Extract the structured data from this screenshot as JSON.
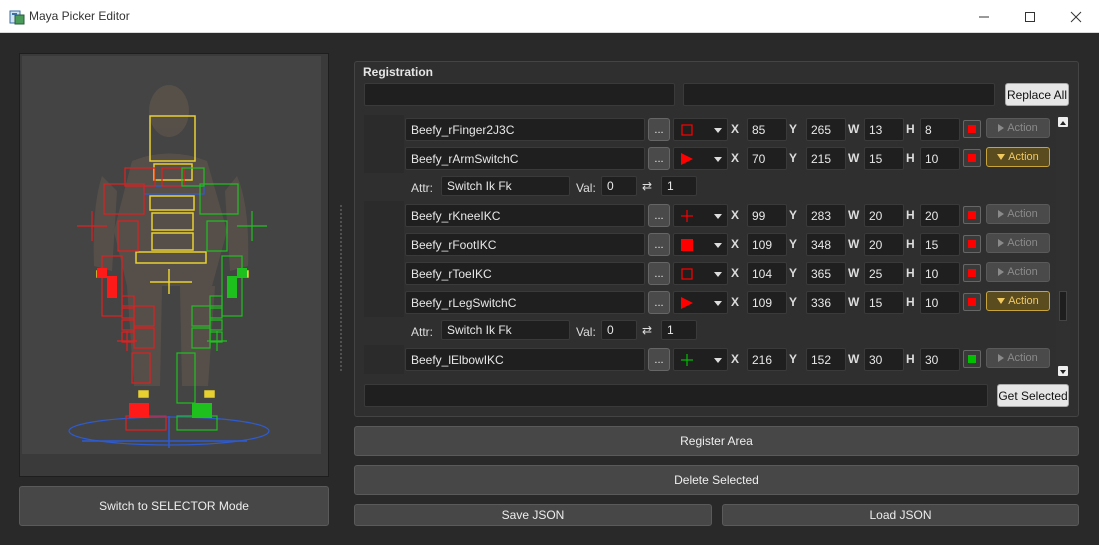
{
  "window": {
    "title": "Maya Picker Editor",
    "icons": {
      "app": "maya-app-icon",
      "minimize": "minimize-icon",
      "maximize": "maximize-icon",
      "close": "close-icon"
    }
  },
  "left": {
    "mode_button": "Switch to SELECTOR Mode"
  },
  "registration": {
    "title": "Registration",
    "find_value": "",
    "replace_value": "",
    "replace_all_label": "Replace All",
    "axis_labels": {
      "x": "X",
      "y": "Y",
      "w": "W",
      "h": "H"
    },
    "dots_label": "...",
    "attr_label": "Attr:",
    "val_label": "Val:",
    "swap_glyph": "⇄",
    "rows": [
      {
        "kind": "item",
        "name": "Beefy_rFinger2J3C",
        "shape": "square-outline",
        "color": "#ff0000",
        "x": "85",
        "y": "265",
        "w": "13",
        "h": "8",
        "action": "Action",
        "action_on": false
      },
      {
        "kind": "item",
        "name": "Beefy_rArmSwitchC",
        "shape": "triangle",
        "color": "#ff0000",
        "x": "70",
        "y": "215",
        "w": "15",
        "h": "10",
        "action": "Action",
        "action_on": true
      },
      {
        "kind": "attr",
        "attr": "Switch Ik Fk",
        "val": "0",
        "val2": "1"
      },
      {
        "kind": "item",
        "name": "Beefy_rKneeIKC",
        "shape": "cross",
        "color": "#ff0000",
        "x": "99",
        "y": "283",
        "w": "20",
        "h": "20",
        "action": "Action",
        "action_on": false
      },
      {
        "kind": "item",
        "name": "Beefy_rFootIKC",
        "shape": "square-filled",
        "color": "#ff0000",
        "x": "109",
        "y": "348",
        "w": "20",
        "h": "15",
        "action": "Action",
        "action_on": false
      },
      {
        "kind": "item",
        "name": "Beefy_rToeIKC",
        "shape": "square-outline",
        "color": "#ff0000",
        "x": "104",
        "y": "365",
        "w": "25",
        "h": "10",
        "action": "Action",
        "action_on": false
      },
      {
        "kind": "item",
        "name": "Beefy_rLegSwitchC",
        "shape": "triangle",
        "color": "#ff0000",
        "x": "109",
        "y": "336",
        "w": "15",
        "h": "10",
        "action": "Action",
        "action_on": true
      },
      {
        "kind": "attr",
        "attr": "Switch Ik Fk",
        "val": "0",
        "val2": "1"
      },
      {
        "kind": "item",
        "name": "Beefy_lElbowIKC",
        "shape": "cross",
        "color": "#00c000",
        "x": "216",
        "y": "152",
        "w": "30",
        "h": "30",
        "action": "Action",
        "action_on": false
      }
    ],
    "selection_value": "",
    "get_selected_label": "Get Selected"
  },
  "actions": {
    "register_area": "Register Area",
    "delete_selected": "Delete Selected",
    "save_json": "Save JSON",
    "load_json": "Load JSON"
  }
}
